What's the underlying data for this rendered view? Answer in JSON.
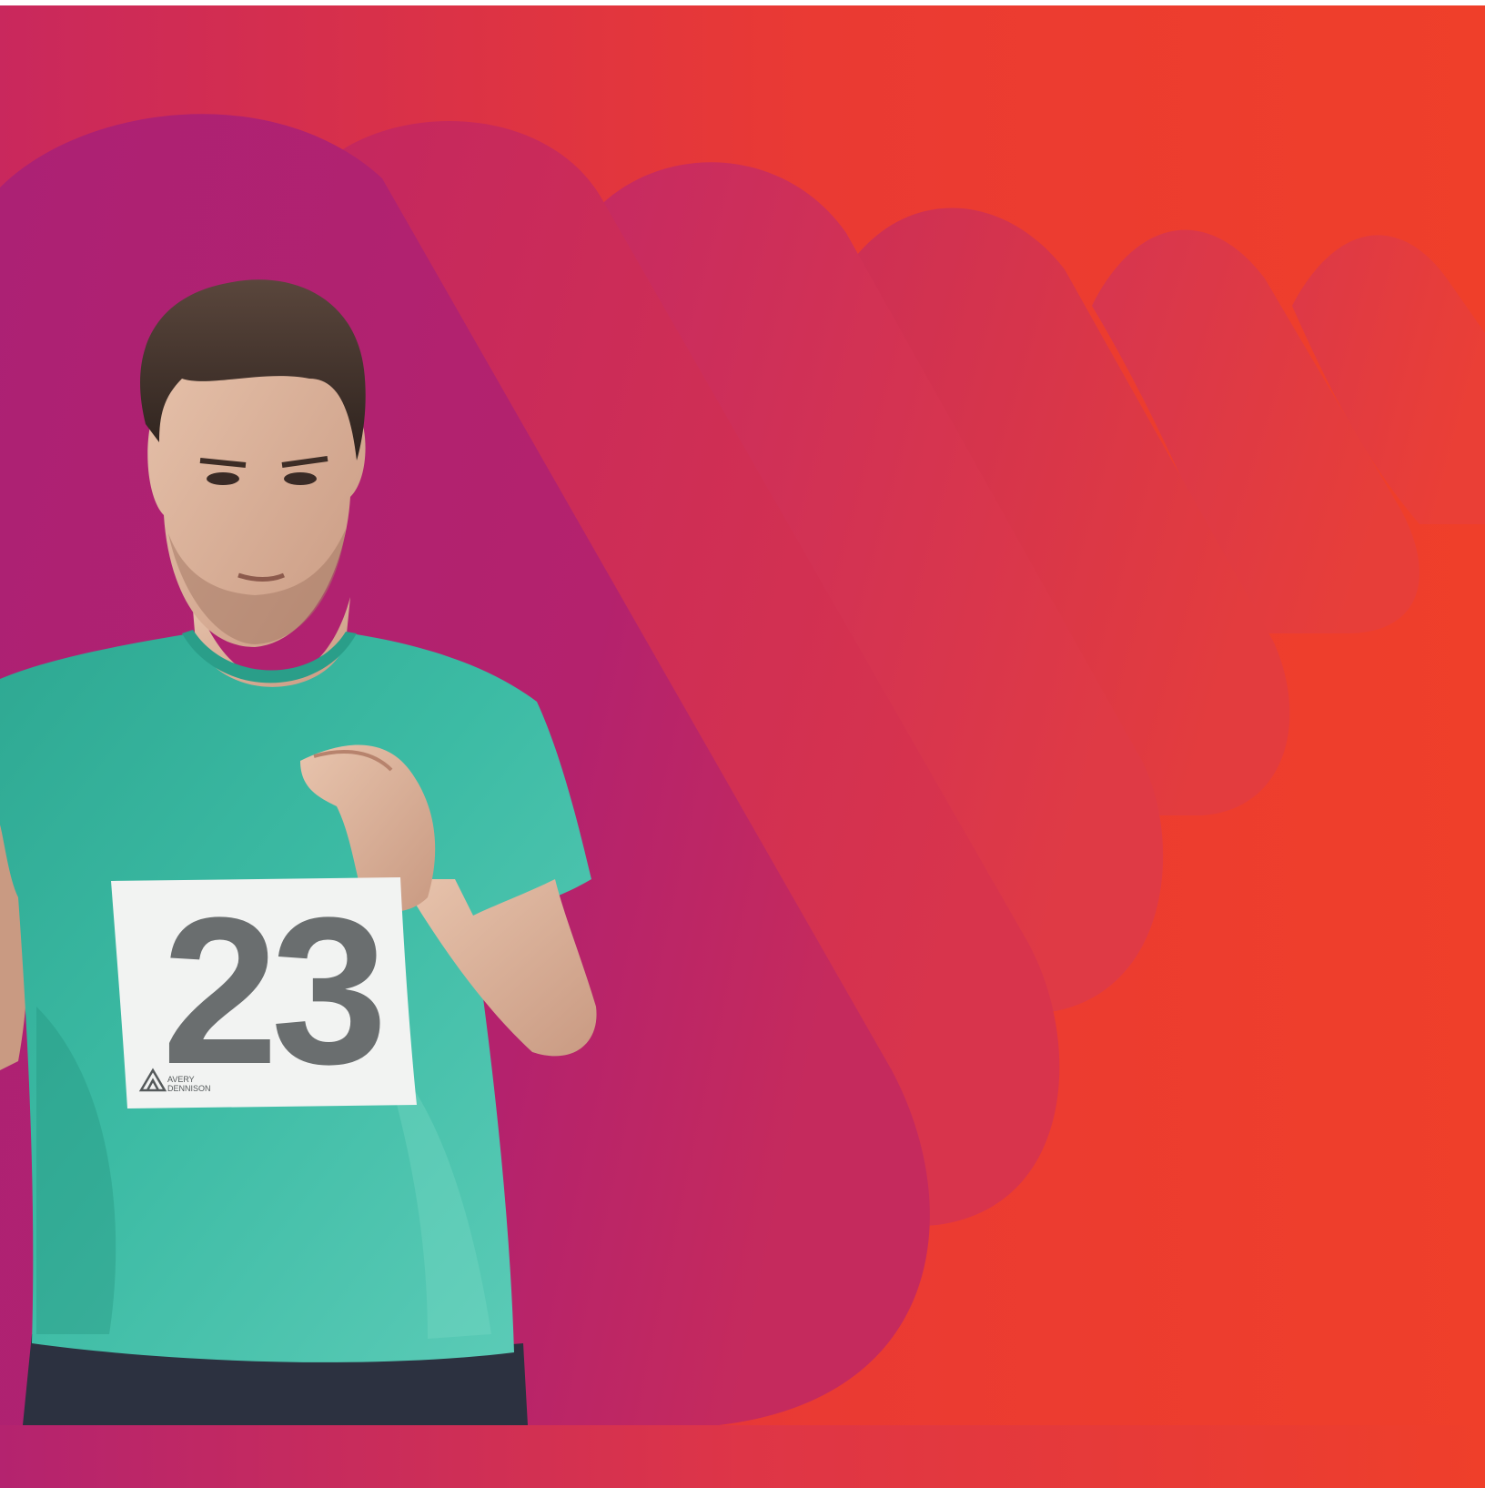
{
  "bib": {
    "number": "23",
    "logo_line1": "AVERY",
    "logo_line2": "DENNISON"
  },
  "colors": {
    "orange": "#ee3c2b",
    "magenta": "#b3226f",
    "rose": "#dd3546",
    "jersey": "#36b39c",
    "shorts": "#2c3140",
    "bib_paper": "#f2f3f2",
    "bib_ink": "#6a6e6f"
  }
}
